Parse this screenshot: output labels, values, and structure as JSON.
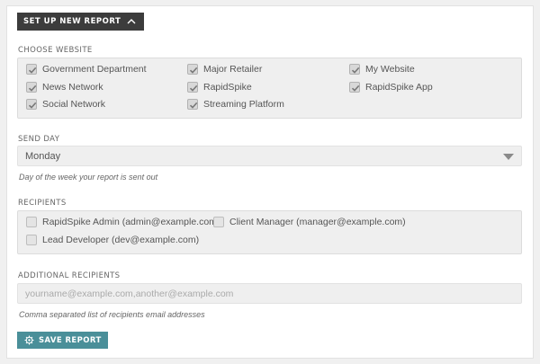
{
  "header": {
    "setup_label": "SET UP NEW REPORT"
  },
  "website": {
    "label": "CHOOSE WEBSITE",
    "items": [
      {
        "label": "Government Department",
        "checked": true
      },
      {
        "label": "Major Retailer",
        "checked": true
      },
      {
        "label": "My Website",
        "checked": true
      },
      {
        "label": "News Network",
        "checked": true
      },
      {
        "label": "RapidSpike",
        "checked": true
      },
      {
        "label": "RapidSpike App",
        "checked": true
      },
      {
        "label": "Social Network",
        "checked": true
      },
      {
        "label": "Streaming Platform",
        "checked": true
      }
    ]
  },
  "send_day": {
    "label": "SEND DAY",
    "selected": "Monday",
    "help": "Day of the week your report is sent out"
  },
  "recipients": {
    "label": "RECIPIENTS",
    "items": [
      {
        "label": "RapidSpike Admin (admin@example.com)",
        "checked": false
      },
      {
        "label": "Client Manager (manager@example.com)",
        "checked": false
      },
      {
        "label": "Lead Developer (dev@example.com)",
        "checked": false
      }
    ]
  },
  "additional": {
    "label": "ADDITIONAL RECIPIENTS",
    "placeholder": "yourname@example.com,another@example.com",
    "value": "",
    "help": "Comma separated list of recipients email addresses"
  },
  "actions": {
    "save_label": "SAVE REPORT"
  },
  "colors": {
    "dark_button": "#3c3c3c",
    "save_button": "#4a8f99"
  },
  "icons": {
    "setup": "chevron-up-icon",
    "save": "gear-icon",
    "check": "check-icon",
    "select": "caret-down-icon"
  }
}
